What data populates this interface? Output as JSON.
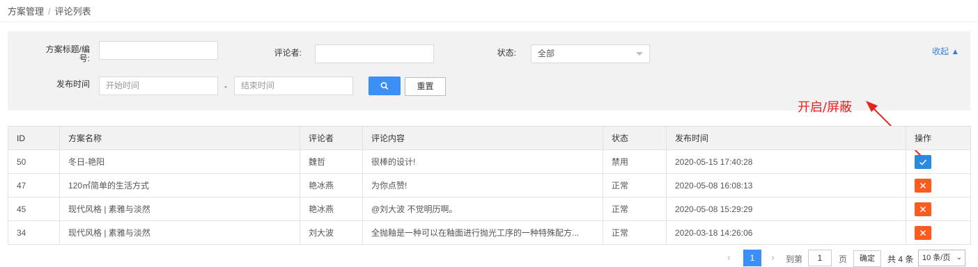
{
  "breadcrumb": {
    "parent": "方案管理",
    "separator": "/",
    "current": "评论列表"
  },
  "filter": {
    "title_label": "方案标题/编号:",
    "title_value": "",
    "reviewer_label": "评论者:",
    "reviewer_value": "",
    "status_label": "状态:",
    "status_selected": "全部",
    "date_label": "发布时间",
    "start_placeholder": "开始时间",
    "end_placeholder": "结束时间",
    "date_sep": "-",
    "search_icon": "search-icon",
    "reset_label": "重置",
    "collapse_label": "收起 ▲"
  },
  "annotation": {
    "text": "开启/屏蔽",
    "color": "#e4231b"
  },
  "table": {
    "headers": [
      "ID",
      "方案名称",
      "评论者",
      "评论内容",
      "状态",
      "发布时间",
      "操作"
    ],
    "rows": [
      {
        "id": "50",
        "name": "冬日-艳阳",
        "reviewer": "魏哲",
        "content": "很棒的设计!",
        "status": "禁用",
        "time": "2020-05-15 17:40:28",
        "action": "enable"
      },
      {
        "id": "47",
        "name": "120㎡简单的生活方式",
        "reviewer": "艳冰燕",
        "content": "为你点赞!",
        "status": "正常",
        "time": "2020-05-08 16:08:13",
        "action": "disable"
      },
      {
        "id": "45",
        "name": "现代风格 | 素雅与淡然",
        "reviewer": "艳冰燕",
        "content": "@刘大波 不觉明历啊。",
        "status": "正常",
        "time": "2020-05-08 15:29:29",
        "action": "disable"
      },
      {
        "id": "34",
        "name": "现代风格 | 素雅与淡然",
        "reviewer": "刘大波",
        "content": "全抛釉是一种可以在釉面进行抛光工序的一种特殊配方...",
        "status": "正常",
        "time": "2020-03-18 14:26:06",
        "action": "disable"
      }
    ]
  },
  "pagination": {
    "prev": "‹",
    "current_page": "1",
    "next": "›",
    "goto_label": "到第",
    "goto_value": "1",
    "page_unit": "页",
    "confirm_label": "确定",
    "total": "共 4 条",
    "page_size": "10 条/页"
  },
  "colors": {
    "primary": "#3c8ff5",
    "enable": "#2a8ae2",
    "disable": "#ff5b1f",
    "link": "#3c7fd8"
  }
}
